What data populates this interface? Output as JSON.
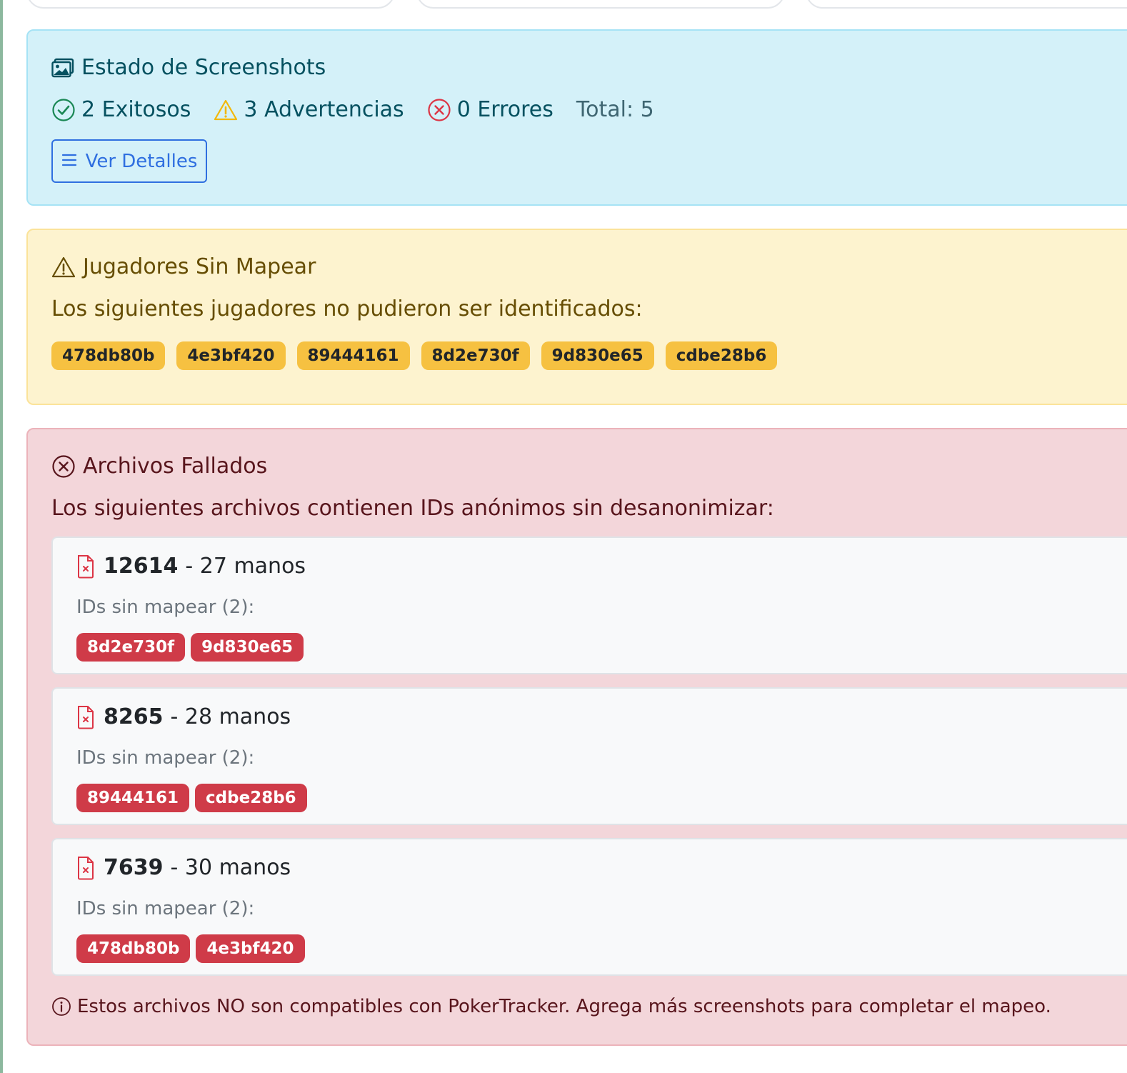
{
  "screenshots": {
    "title": "Estado de Screenshots",
    "success": "2 Exitosos",
    "warnings": "3 Advertencias",
    "errors": "0 Errores",
    "total": "Total: 5",
    "details_button": "Ver Detalles",
    "icon": "image-icon"
  },
  "unmapped_players": {
    "title": "Jugadores Sin Mapear",
    "description": "Los siguientes jugadores no pudieron ser identificados:",
    "ids": [
      "478db80b",
      "4e3bf420",
      "89444161",
      "8d2e730f",
      "9d830e65",
      "cdbe28b6"
    ],
    "icon": "warning-triangle-icon"
  },
  "failed_files": {
    "title": "Archivos Fallados",
    "description": "Los siguientes archivos contienen IDs anónimos sin desanonimizar:",
    "files": [
      {
        "id": "12614",
        "hands": "- 27 manos",
        "unmapped_label": "IDs sin mapear (2):",
        "ids": [
          "8d2e730f",
          "9d830e65"
        ]
      },
      {
        "id": "8265",
        "hands": "- 28 manos",
        "unmapped_label": "IDs sin mapear (2):",
        "ids": [
          "89444161",
          "cdbe28b6"
        ]
      },
      {
        "id": "7639",
        "hands": "- 30 manos",
        "unmapped_label": "IDs sin mapear (2):",
        "ids": [
          "478db80b",
          "4e3bf420"
        ]
      }
    ],
    "footnote": "Estos archivos NO son compatibles con PokerTracker. Agrega más screenshots para completar el mapeo.",
    "icon": "x-circle-icon"
  },
  "colors": {
    "info_bg": "#d4f1f9",
    "warning_bg": "#fdf3cf",
    "danger_bg": "#f3d6da",
    "warning_badge": "#f6c141",
    "danger_badge": "#cf3b48",
    "primary": "#2f6fe0",
    "success": "#198754"
  }
}
